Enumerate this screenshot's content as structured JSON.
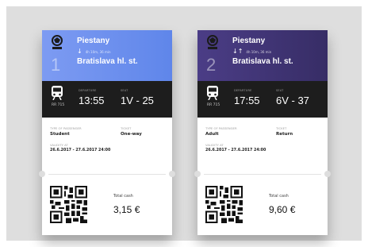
{
  "tickets": [
    {
      "number": "1",
      "from": "Piestany",
      "direction_icon": "arrow-down-icon",
      "direction_glyph": "↓",
      "duration": "4h 10m, 36 min",
      "to": "Bratislava hl. st.",
      "train_no": "RR 715",
      "departure_label": "Departure",
      "departure": "13:55",
      "seat_label": "Seat",
      "seat": "1V - 25",
      "passenger_type_label": "Type of passenger",
      "passenger_type": "Student",
      "ticket_label": "Ticket",
      "ticket_type": "One-way",
      "validity_label": "Validity at",
      "validity": "26.6.2017 - 27.6.2017 24:00",
      "total_label": "Total cash",
      "total": "3,15 €",
      "color": "#6d8fee"
    },
    {
      "number": "2",
      "from": "Piestany",
      "direction_icon": "arrow-down-up-icon",
      "direction_glyph": "↓↑",
      "duration": "4h 10m, 36 min",
      "to": "Bratislava hl. st.",
      "train_no": "RR 715",
      "departure_label": "Departure",
      "departure": "17:55",
      "seat_label": "Seat",
      "seat": "6V - 37",
      "passenger_type_label": "Type of passenger",
      "passenger_type": "Adult",
      "ticket_label": "Ticket",
      "ticket_type": "Return",
      "validity_label": "Validity at",
      "validity": "26.6.2017 - 27.6.2017 24:00",
      "total_label": "Total cash",
      "total": "9,60 €",
      "color": "#413475"
    }
  ],
  "colors": {
    "background": "#dedede",
    "ticket_dark_bar": "#1d1d1d"
  }
}
